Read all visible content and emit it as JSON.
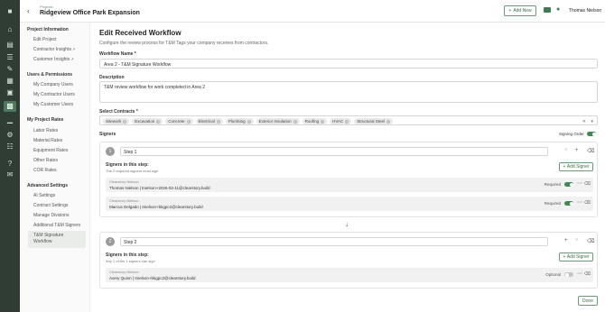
{
  "topbar": {
    "breadcrumb": "Projects",
    "project_title": "Ridgeview Office Park Expansion",
    "add_new": "Add New",
    "user_name": "Thomas Nielson"
  },
  "sidebar": {
    "project_information": {
      "title": "Project Information",
      "items": [
        "Edit Project",
        "Contractor Insights",
        "Customer Insights"
      ]
    },
    "users_permissions": {
      "title": "Users & Permissions",
      "items": [
        "My Company Users",
        "My Contractor Users",
        "My Customer Users"
      ]
    },
    "my_project_rates": {
      "title": "My Project Rates",
      "items": [
        "Labor Rates",
        "Material Rates",
        "Equipment Rates",
        "Other Rates",
        "COR Rates"
      ]
    },
    "advanced_settings": {
      "title": "Advanced Settings",
      "items": [
        "AI Settings",
        "Contract Settings",
        "Manage Divisions",
        "Additional T&M Signers"
      ],
      "selected_line1": "T&M Signature",
      "selected_line2": "Workflow"
    }
  },
  "form": {
    "heading": "Edit Received Workflow",
    "subheading": "Configure the review process for T&M Tags your company receives from contractors.",
    "workflow_name_label": "Workflow Name *",
    "workflow_name_value": "Area 2 - T&M Signature Workflow",
    "description_label": "Description",
    "description_value": "T&M review workflow for work completed in Area 2",
    "contracts_label": "Select Contracts *",
    "contracts": [
      "Sitework",
      "Excavation",
      "Concrete",
      "Electrical",
      "Plumbing",
      "Exterior Insulation",
      "Roofing",
      "HVAC",
      "Structural Steel"
    ],
    "signers_label": "Signers",
    "signing_order_label": "Signing Order",
    "signing_order_on": true
  },
  "steps": [
    {
      "number": "1",
      "name": "Step 1",
      "signers_title": "Signers in this step:",
      "signers_desc": "The 2 required signers must sign",
      "add_signer": "Add Signer",
      "signers": [
        {
          "company": "Clearstory Nielson",
          "person": "Thomas Nielson  |  tnielson+2026-02-11@clearstory.build",
          "requirement": "Required",
          "toggle_on": true
        },
        {
          "company": "Clearstory Nielson",
          "person": "Marcus Delgado  |  tnielson+bkgpc2@clearstory.build",
          "requirement": "Required",
          "toggle_on": true
        }
      ]
    },
    {
      "number": "2",
      "name": "Step 2",
      "signers_title": "Signers in this step:",
      "signers_desc": "Any 1 of the 1 signers can sign",
      "add_signer": "Add Signer",
      "signers": [
        {
          "company": "Clearstory Nielson",
          "person": "Avery Quinn  |  tnielson+bkgpc2@clearstory.build",
          "requirement": "Optional",
          "toggle_on": false
        }
      ]
    }
  ],
  "done_label": "Done",
  "icons": {
    "rail": [
      "building-icon",
      "home-icon",
      "document-icon",
      "list-icon",
      "pencil-icon",
      "calculator-icon",
      "box-icon",
      "briefcase-icon",
      "chart-icon",
      "gear-icon",
      "grid-icon",
      "help-icon",
      "chat-icon"
    ]
  },
  "colors": {
    "rail_bg": "#2f3d35",
    "accent": "#3e8a53"
  }
}
